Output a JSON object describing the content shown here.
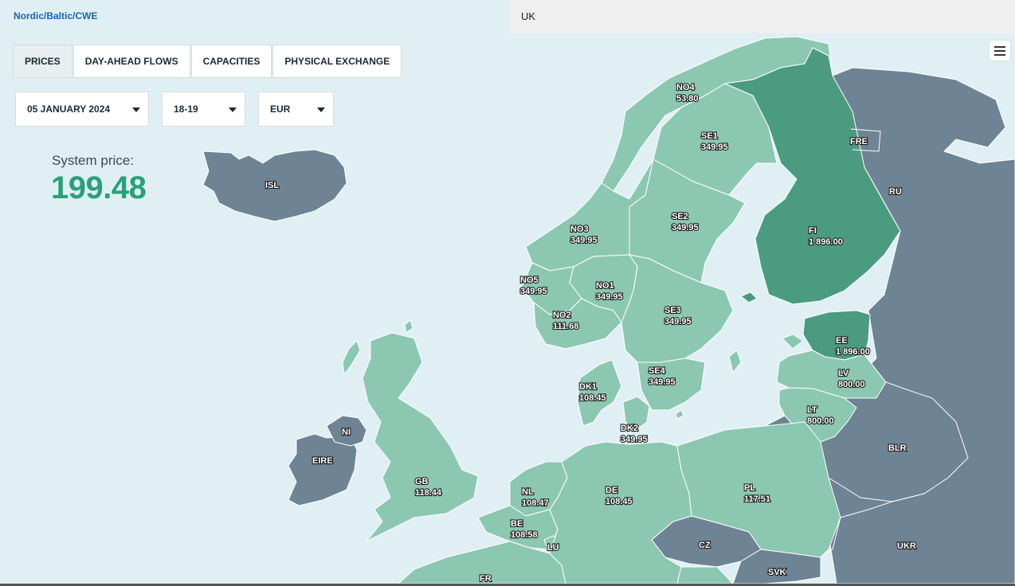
{
  "header": {
    "region_nordic": "Nordic/Baltic/CWE",
    "region_uk": "UK"
  },
  "tabs": [
    "PRICES",
    "DAY-AHEAD FLOWS",
    "CAPACITIES",
    "PHYSICAL EXCHANGE"
  ],
  "active_tab": "PRICES",
  "filters": {
    "date": "05 JANUARY 2024",
    "hour": "18-19",
    "currency": "EUR"
  },
  "system_price": {
    "label": "System price:",
    "value": "199.48"
  },
  "colors": {
    "low": "#8cc7b2",
    "high": "#4a9b80",
    "non_member": "#6e8393",
    "sea": "#e0eff4",
    "accent": "#2aa079"
  },
  "icons": {
    "menu": "hamburger-menu-icon",
    "dropdown": "caret-down-icon"
  },
  "zones": [
    {
      "code": "NO4",
      "price": "53.80"
    },
    {
      "code": "SE1",
      "price": "349.95"
    },
    {
      "code": "FRE",
      "price": ""
    },
    {
      "code": "RU",
      "price": ""
    },
    {
      "code": "ISL",
      "price": ""
    },
    {
      "code": "SE2",
      "price": "349.95"
    },
    {
      "code": "NO3",
      "price": "349.95"
    },
    {
      "code": "FI",
      "price": "1 896.00"
    },
    {
      "code": "NO5",
      "price": "349.95"
    },
    {
      "code": "NO1",
      "price": "349.95"
    },
    {
      "code": "SE3",
      "price": "349.95"
    },
    {
      "code": "NO2",
      "price": "111.68"
    },
    {
      "code": "EE",
      "price": "1 896.00"
    },
    {
      "code": "SE4",
      "price": "349.95"
    },
    {
      "code": "LV",
      "price": "800.00"
    },
    {
      "code": "DK1",
      "price": "108.45"
    },
    {
      "code": "LT",
      "price": "800.00"
    },
    {
      "code": "NI",
      "price": ""
    },
    {
      "code": "DK2",
      "price": "349.95"
    },
    {
      "code": "BLR",
      "price": ""
    },
    {
      "code": "EIRE",
      "price": ""
    },
    {
      "code": "GB",
      "price": "118.44"
    },
    {
      "code": "NL",
      "price": "108.47"
    },
    {
      "code": "DE",
      "price": "108.45"
    },
    {
      "code": "PL",
      "price": "117.51"
    },
    {
      "code": "BE",
      "price": "108.58"
    },
    {
      "code": "CZ",
      "price": ""
    },
    {
      "code": "UKR",
      "price": ""
    },
    {
      "code": "LU",
      "price": ""
    },
    {
      "code": "SVK",
      "price": ""
    },
    {
      "code": "FR",
      "price": ""
    }
  ]
}
